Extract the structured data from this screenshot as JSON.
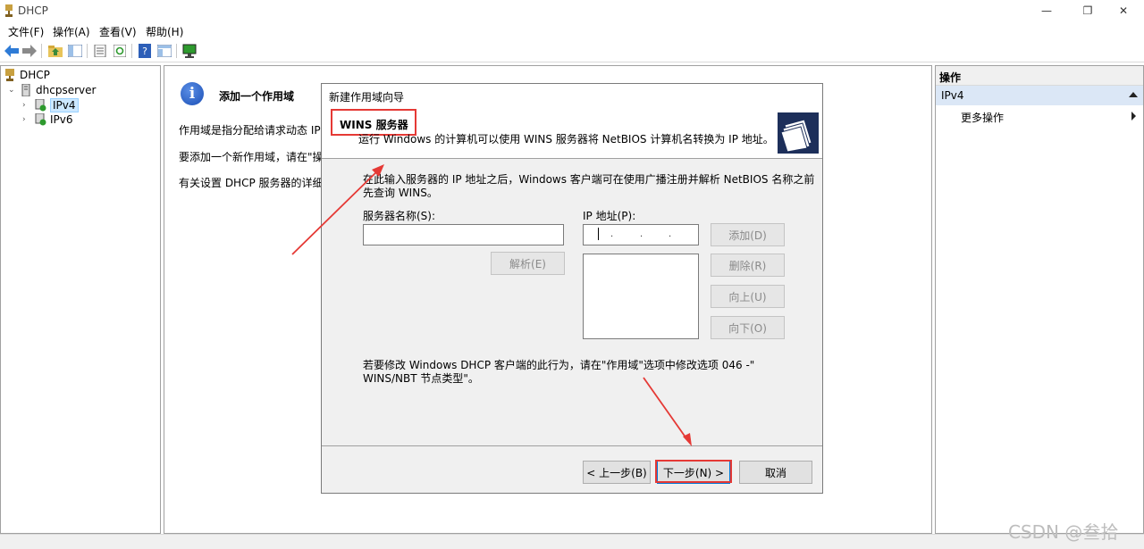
{
  "window": {
    "title": "DHCP",
    "minimize": "—",
    "maximize": "❐",
    "close": "✕"
  },
  "menu": {
    "items": [
      "文件(F)",
      "操作(A)",
      "查看(V)",
      "帮助(H)"
    ]
  },
  "toolbar": {
    "icons": [
      "back-arrow-icon",
      "forward-arrow-icon",
      "folder-up-icon",
      "show-hide-tree-icon",
      "properties-icon",
      "refresh-icon",
      "help-icon",
      "console-icon",
      "monitor-icon"
    ]
  },
  "tree": {
    "root": "DHCP",
    "server": "dhcpserver",
    "ipv4": "IPv4",
    "ipv6": "IPv6"
  },
  "center": {
    "title": "添加一个作用域",
    "line1": "作用域是指分配给请求动态 IP 地",
    "line2": "要添加一个新作用域，请在\"操作",
    "line3": "有关设置 DHCP 服务器的详细情"
  },
  "actions": {
    "header": "操作",
    "selected": "IPv4",
    "more": "更多操作"
  },
  "dialog": {
    "title": "新建作用域向导",
    "heading": "WINS 服务器",
    "subtext": "运行 Windows 的计算机可以使用 WINS 服务器将 NetBIOS 计算机名转换为 IP 地址。",
    "intro_line1": "在此输入服务器的 IP 地址之后，Windows 客户端可在使用广播注册并解析 NetBIOS 名称之前",
    "intro_line2": "先查询 WINS。",
    "server_name_label": "服务器名称(S):",
    "ip_label": "IP 地址(P):",
    "resolve_button": "解析(E)",
    "add_button": "添加(D)",
    "remove_button": "删除(R)",
    "up_button": "向上(U)",
    "down_button": "向下(O)",
    "note_line1": "若要修改 Windows DHCP 客户端的此行为，请在\"作用域\"选项中修改选项 046 -\"",
    "note_line2": "WINS/NBT 节点类型\"。",
    "back_button": "< 上一步(B)",
    "next_button": "下一步(N) >",
    "cancel_button": "取消",
    "server_name_value": "",
    "ip_value": ""
  },
  "watermark": "CSDN @叁拾",
  "colors": {
    "annotation_red": "#e53935",
    "selection_blue": "#cce8ff",
    "accent_blue": "#0078d7"
  }
}
